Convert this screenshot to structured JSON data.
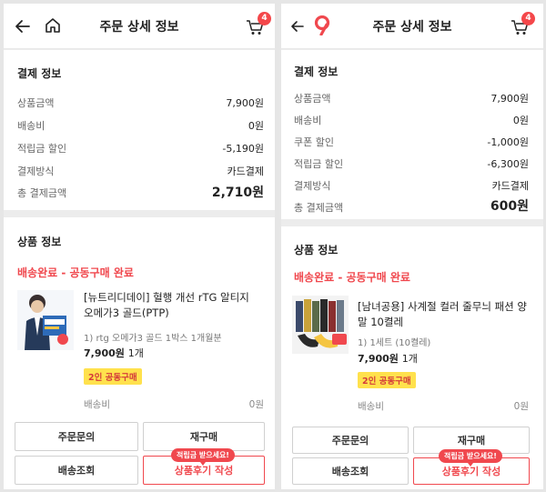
{
  "left": {
    "header": {
      "title": "주문 상세 정보",
      "cart_count": "4"
    },
    "payment": {
      "title": "결제 정보",
      "rows": [
        {
          "label": "상품금액",
          "value": "7,900원"
        },
        {
          "label": "배송비",
          "value": "0원"
        },
        {
          "label": "적립금 할인",
          "value": "-5,190원"
        },
        {
          "label": "결제방식",
          "value": "카드결제"
        },
        {
          "label": "총 결제금액",
          "value": "2,710원"
        }
      ]
    },
    "product": {
      "title": "상품 정보",
      "status": "배송완료 - 공동구매 완료",
      "name": "[뉴트리디데이] 혈행 개선 rTG 알티지 오메가3 골드(PTP)",
      "option": "1) rtg 오메가3 골드 1박스 1개월분",
      "price": "7,900원",
      "qty": "1개",
      "badge": "2인 공동구매",
      "shipping_label": "배송비",
      "shipping_value": "0원"
    },
    "buttons": {
      "inquiry": "주문문의",
      "reorder": "재구매",
      "tracking": "배송조회",
      "review": "상품후기 작성",
      "tooltip": "적립금 받으세요!"
    }
  },
  "right": {
    "header": {
      "title": "주문 상세 정보",
      "cart_count": "4"
    },
    "payment": {
      "title": "결제 정보",
      "rows": [
        {
          "label": "상품금액",
          "value": "7,900원"
        },
        {
          "label": "배송비",
          "value": "0원"
        },
        {
          "label": "쿠폰 할인",
          "value": "-1,000원"
        },
        {
          "label": "적립금 할인",
          "value": "-6,300원"
        },
        {
          "label": "결제방식",
          "value": "카드결제"
        },
        {
          "label": "총 결제금액",
          "value": "600원"
        }
      ]
    },
    "product": {
      "title": "상품 정보",
      "status": "배송완료 - 공동구매 완료",
      "name": "[남녀공용] 사계절 컬러 줄무늬 패션 양말 10켤레",
      "option": "1) 1세트 (10켤레)",
      "price": "7,900원",
      "qty": "1개",
      "badge": "2인 공동구매",
      "shipping_label": "배송비",
      "shipping_value": "0원"
    },
    "buttons": {
      "inquiry": "주문문의",
      "reorder": "재구매",
      "tracking": "배송조회",
      "review": "상품후기 작성",
      "tooltip": "적립금 받으세요!"
    }
  },
  "colors": {
    "accent": "#f0484e",
    "badge_bg": "#ffe14d",
    "cart_badge": "#f4474a"
  },
  "icons": [
    "back-arrow-icon",
    "home-icon",
    "app-logo-icon",
    "cart-icon"
  ]
}
